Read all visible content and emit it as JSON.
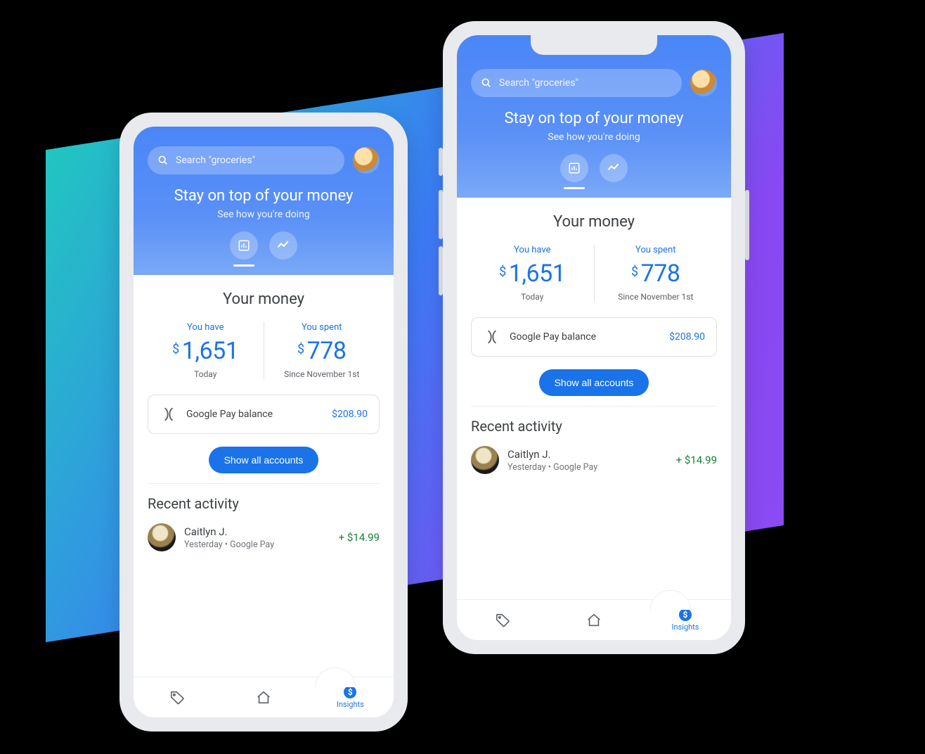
{
  "search": {
    "placeholder": "Search \"groceries\""
  },
  "hero": {
    "title": "Stay on top of your money",
    "subtitle": "See how you're doing"
  },
  "money": {
    "heading": "Your money",
    "have": {
      "label": "You have",
      "currency": "$",
      "amount": "1,651",
      "sub": "Today"
    },
    "spent": {
      "label": "You spent",
      "currency": "$",
      "amount": "778",
      "sub": "Since November 1st"
    }
  },
  "balance_card": {
    "label": "Google Pay balance",
    "value": "$208.90"
  },
  "show_all_label": "Show all accounts",
  "recent": {
    "heading": "Recent activity",
    "item": {
      "name": "Caitlyn J.",
      "sub": "Yesterday • Google Pay",
      "amount": "+ $14.99"
    }
  },
  "nav": {
    "insights": "Insights"
  }
}
